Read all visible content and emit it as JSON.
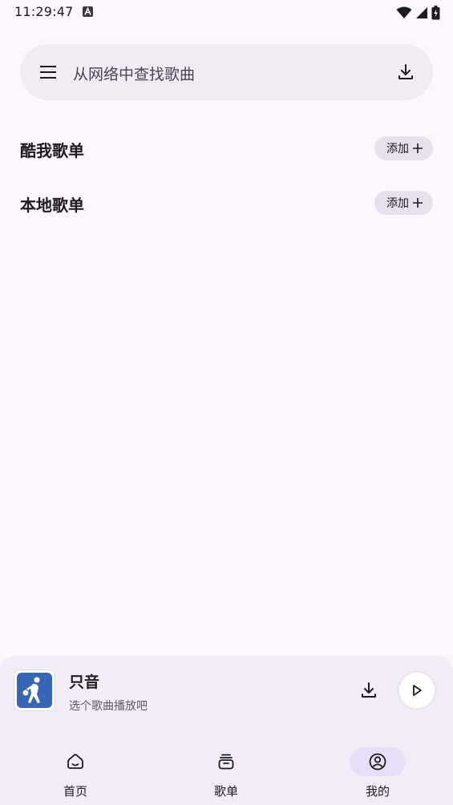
{
  "status_bar": {
    "time": "11:29:47"
  },
  "search": {
    "placeholder": "从网络中查找歌曲"
  },
  "sections": [
    {
      "title": "酷我歌单",
      "add_label": "添加"
    },
    {
      "title": "本地歌单",
      "add_label": "添加"
    }
  ],
  "player": {
    "title": "只音",
    "subtitle": "选个歌曲播放吧"
  },
  "nav": {
    "items": [
      {
        "label": "首页",
        "icon": "home-icon",
        "active": false
      },
      {
        "label": "歌单",
        "icon": "playlist-icon",
        "active": false
      },
      {
        "label": "我的",
        "icon": "account-icon",
        "active": true
      }
    ]
  },
  "colors": {
    "background": "#fdf7fd",
    "surface": "#f1ecf4",
    "chip": "#e8e0ec",
    "nav_active": "#e8def8",
    "album": "#3766b6"
  }
}
